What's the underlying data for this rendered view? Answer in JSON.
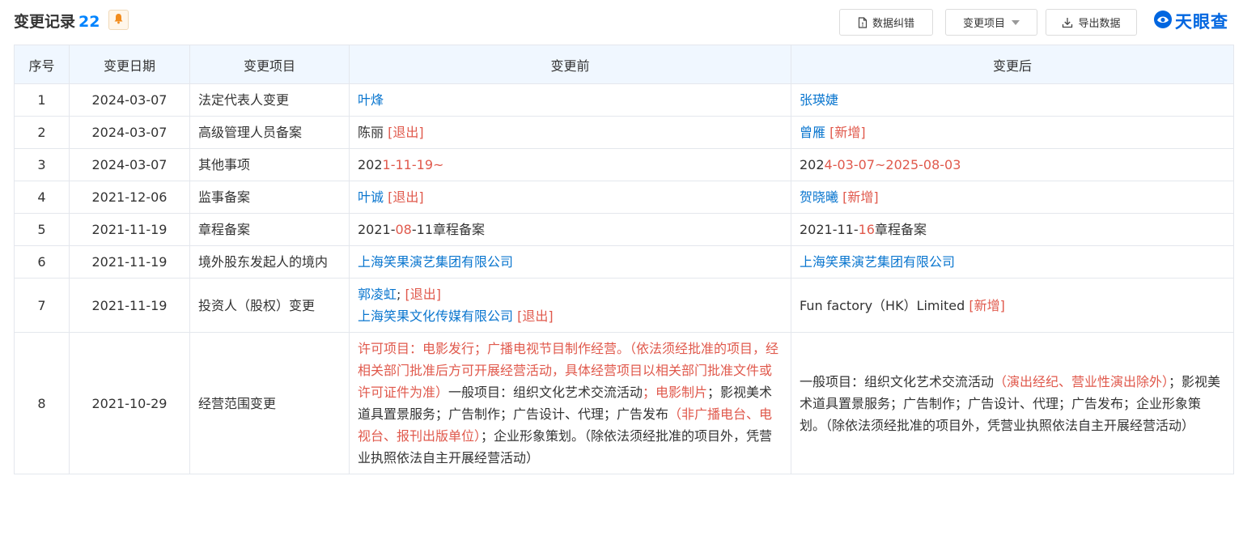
{
  "header": {
    "title": "变更记录",
    "count": "22",
    "buttons": {
      "correct": "数据纠错",
      "type": "变更项目",
      "export": "导出数据"
    },
    "logo_text": "天眼查"
  },
  "table": {
    "columns": [
      "序号",
      "变更日期",
      "变更项目",
      "变更前",
      "变更后"
    ],
    "rows": [
      {
        "no": "1",
        "date": "2024-03-07",
        "item": "法定代表人变更",
        "before": [
          [
            {
              "t": "叶烽",
              "c": "blue"
            }
          ]
        ],
        "after": [
          [
            {
              "t": "张瑛婕",
              "c": "blue"
            }
          ]
        ]
      },
      {
        "no": "2",
        "date": "2024-03-07",
        "item": "高级管理人员备案",
        "before": [
          [
            {
              "t": "陈丽 ",
              "c": "plain"
            },
            {
              "t": "[退出]",
              "c": "red"
            }
          ]
        ],
        "after": [
          [
            {
              "t": "曾雁 ",
              "c": "blue"
            },
            {
              "t": "[新增]",
              "c": "red"
            }
          ]
        ]
      },
      {
        "no": "3",
        "date": "2024-03-07",
        "item": "其他事项",
        "before": [
          [
            {
              "t": "202",
              "c": "plain"
            },
            {
              "t": "1-11-19~",
              "c": "red"
            }
          ]
        ],
        "after": [
          [
            {
              "t": "202",
              "c": "plain"
            },
            {
              "t": "4-03-07~2025-08-03",
              "c": "red"
            }
          ]
        ]
      },
      {
        "no": "4",
        "date": "2021-12-06",
        "item": "监事备案",
        "before": [
          [
            {
              "t": "叶诚 ",
              "c": "blue"
            },
            {
              "t": "[退出]",
              "c": "red"
            }
          ]
        ],
        "after": [
          [
            {
              "t": "贺晓曦 ",
              "c": "blue"
            },
            {
              "t": "[新增]",
              "c": "red"
            }
          ]
        ]
      },
      {
        "no": "5",
        "date": "2021-11-19",
        "item": "章程备案",
        "before": [
          [
            {
              "t": "2021-",
              "c": "plain"
            },
            {
              "t": "08",
              "c": "red"
            },
            {
              "t": "-11章程备案",
              "c": "plain"
            }
          ]
        ],
        "after": [
          [
            {
              "t": "2021-11-",
              "c": "plain"
            },
            {
              "t": "16",
              "c": "red"
            },
            {
              "t": "章程备案",
              "c": "plain"
            }
          ]
        ]
      },
      {
        "no": "6",
        "date": "2021-11-19",
        "item": "境外股东发起人的境内",
        "before": [
          [
            {
              "t": "上海笑果演艺集团有限公司",
              "c": "blue"
            }
          ]
        ],
        "after": [
          [
            {
              "t": "上海笑果演艺集团有限公司",
              "c": "blue"
            }
          ]
        ]
      },
      {
        "no": "7",
        "date": "2021-11-19",
        "item": "投资人（股权）变更",
        "before": [
          [
            {
              "t": "郭凌虹",
              "c": "blue"
            },
            {
              "t": "; ",
              "c": "plain"
            },
            {
              "t": "[退出]",
              "c": "red"
            }
          ],
          [
            {
              "t": "上海笑果文化传媒有限公司 ",
              "c": "blue"
            },
            {
              "t": "[退出]",
              "c": "red"
            }
          ]
        ],
        "after": [
          [
            {
              "t": "Fun factory（HK）Limited ",
              "c": "plain"
            },
            {
              "t": "[新增]",
              "c": "red"
            }
          ]
        ]
      },
      {
        "no": "8",
        "date": "2021-10-29",
        "item": "经营范围变更",
        "before": [
          [
            {
              "t": "许可项目：电影发行；广播电视节目制作经营。（依法须经批准的项目，经相关部门批准后方可开展经营活动，具体经营项目以相关部门批准文件或许可证件为准）",
              "c": "red"
            },
            {
              "t": "一般项目：组织文化艺术交流活动",
              "c": "plain"
            },
            {
              "t": "；电影制片",
              "c": "red"
            },
            {
              "t": "；影视美术道具置景服务；广告制作；广告设计、代理；广告发布",
              "c": "plain"
            },
            {
              "t": "（非广播电台、电视台、报刊出版单位）",
              "c": "red"
            },
            {
              "t": "；企业形象策划。（除依法须经批准的项目外，凭营业执照依法自主开展经营活动）",
              "c": "plain"
            }
          ]
        ],
        "after": [
          [
            {
              "t": "一般项目：组织文化艺术交流活动",
              "c": "plain"
            },
            {
              "t": "（演出经纪、营业性演出除外）",
              "c": "red"
            },
            {
              "t": "；影视美术道具置景服务；广告制作；广告设计、代理；广告发布；企业形象策划。（除依法须经批准的项目外，凭营业执照依法自主开展经营活动）",
              "c": "plain"
            }
          ]
        ]
      }
    ]
  },
  "colors": {
    "accent": "#0084ff",
    "link": "#0a76cf",
    "change": "#e0594c",
    "header_bg": "#f0f7ff",
    "border": "#e4e7ed"
  },
  "icons": [
    "bell-icon",
    "document-icon",
    "caret-down-icon",
    "download-icon",
    "tianyancha-logo-icon"
  ]
}
